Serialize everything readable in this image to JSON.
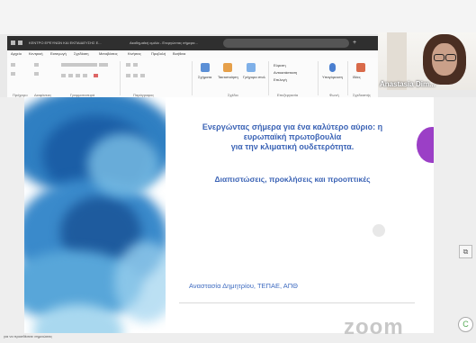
{
  "browser": {
    "tabs": [
      {
        "label": "ΚΕΝΤΡΟ ΕΡΕΥΝΩΝ ΚΑΙ ΕΚΠΑΙΔΕΥΣΗΣ Ε..."
      },
      {
        "label": "Ακαδημαϊκή ομιλία - Ενεργώντας σήμερα..."
      }
    ],
    "new_tab": "+",
    "address": "",
    "menu": [
      "Αρχείο",
      "Κεντρική",
      "Εισαγωγή",
      "Σχεδίαση",
      "Μεταβάσεις",
      "Κινήσεις",
      "Προβολή",
      "Βοήθεια"
    ]
  },
  "ribbon": {
    "groups": [
      "Πρόχειρο",
      "Διαφάνειες",
      "Γραμματοσειρά",
      "Παράγραφος",
      "Σχέδιο",
      "Επεξεργασία",
      "Φωνή",
      "Σχεδιαστής"
    ],
    "buttons": {
      "shapes": "Σχήματα",
      "arrange": "Τακτοποίηση",
      "quick_styles": "Γρήγορα στυλ",
      "find": "Εύρεση",
      "replace": "Αντικατάσταση",
      "select": "Επιλογή",
      "dictate": "Υπαγόρευση",
      "designer": "Ιδέες"
    }
  },
  "video": {
    "participant_name": "Anastasia Dim..."
  },
  "slide": {
    "title_line1": "Ενεργώντας σήμερα για ένα καλύτερο αύριο: η",
    "title_line2": "ευρωπαϊκή πρωτοβουλία",
    "title_line3": "για την κλιματική ουδετερότητα.",
    "subtitle": "Διαπιστώσεις, προκλήσεις και προοπτικές",
    "author": "Αναστασία Δημητρίου, ΤΕΠΑΕ, ΑΠΘ"
  },
  "overlay": {
    "zoom_watermark": "zoom",
    "zoom_logo": "C"
  },
  "status": {
    "text": "για να προσθέσετε σημειώσεις"
  },
  "colors": {
    "title_blue": "#3b63b5",
    "accent_purple": "#9b3fc6",
    "browser_dark": "#2f2f2f"
  }
}
